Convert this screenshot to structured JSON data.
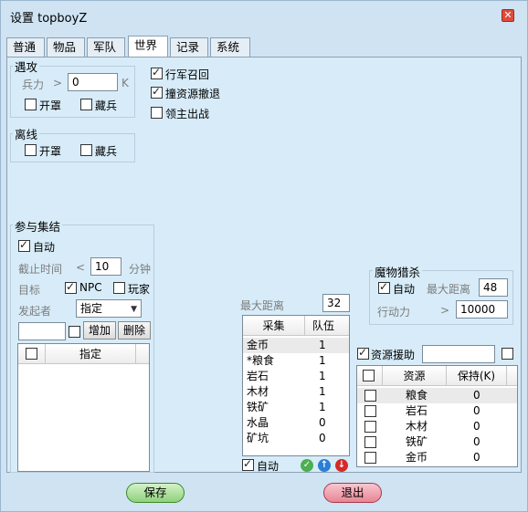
{
  "window": {
    "title": "设置 topboyZ"
  },
  "tabs": [
    {
      "label": "普通"
    },
    {
      "label": "物品"
    },
    {
      "label": "军队"
    },
    {
      "label": "世界"
    },
    {
      "label": "记录"
    },
    {
      "label": "系统"
    }
  ],
  "encounter": {
    "title": "遇攻",
    "troops_label": "兵力",
    "gt": ">",
    "troops_value": "0",
    "unit": "K",
    "open_shield": "开罩",
    "hide_troops": "藏兵"
  },
  "options": {
    "march_recall": "行军召回",
    "resource_retreat": "撞资源撤退",
    "lord_battle": "领主出战"
  },
  "offline": {
    "title": "离线",
    "open_shield": "开罩",
    "hide_troops": "藏兵"
  },
  "rally": {
    "title": "参与集结",
    "auto": "自动",
    "deadline_label": "截止时间",
    "lt": "<",
    "deadline_value": "10",
    "minutes": "分钟",
    "target_label": "目标",
    "npc": "NPC",
    "player": "玩家",
    "initiator_label": "发起者",
    "initiator_value": "指定",
    "input_value": "",
    "add": "增加",
    "delete": "删除",
    "list_header": "指定"
  },
  "gather": {
    "max_distance_label": "最大距离",
    "max_distance_value": "32",
    "col_gather": "采集",
    "col_team": "队伍",
    "rows": [
      {
        "name": "金币",
        "count": "1"
      },
      {
        "name": "*粮食",
        "count": "1"
      },
      {
        "name": "岩石",
        "count": "1"
      },
      {
        "name": "木材",
        "count": "1"
      },
      {
        "name": "铁矿",
        "count": "1"
      },
      {
        "name": "水晶",
        "count": "0"
      },
      {
        "name": "矿坑",
        "count": "0"
      }
    ],
    "auto": "自动"
  },
  "monster": {
    "title": "魔物猎杀",
    "auto": "自动",
    "max_distance_label": "最大距离",
    "max_distance_value": "48",
    "stamina_label": "行动力",
    "gt": ">",
    "stamina_value": "10000"
  },
  "resource_aid": {
    "label": "资源援助",
    "input_value": "",
    "col_resource": "资源",
    "col_keep": "保持(K)",
    "rows": [
      {
        "name": "粮食",
        "value": "0"
      },
      {
        "name": "岩石",
        "value": "0"
      },
      {
        "name": "木材",
        "value": "0"
      },
      {
        "name": "铁矿",
        "value": "0"
      },
      {
        "name": "金币",
        "value": "0"
      }
    ]
  },
  "footer": {
    "save": "保存",
    "exit": "退出"
  }
}
